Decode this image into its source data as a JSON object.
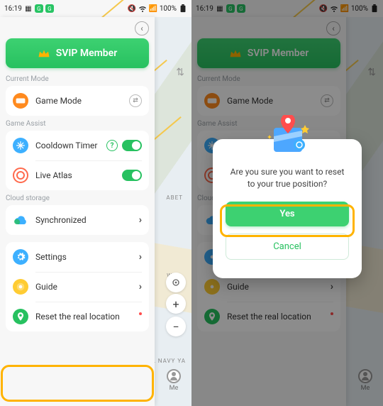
{
  "status": {
    "time": "16:19",
    "battery": "100%",
    "icons": {
      "mute": "mute-icon",
      "wifi": "wifi-icon",
      "signal": "signal-icon",
      "batt": "battery-icon",
      "sq": "app-badge"
    }
  },
  "svip_label": "SVIP Member",
  "sections": {
    "current_mode": "Current Mode",
    "game_assist": "Game Assist",
    "cloud_storage": "Cloud storage"
  },
  "rows": {
    "game_mode": "Game Mode",
    "cooldown": "Cooldown Timer",
    "live_atlas": "Live Atlas",
    "synchronized": "Synchronized",
    "settings": "Settings",
    "guide": "Guide",
    "reset_location": "Reset the real location"
  },
  "map": {
    "loc1": "ABET",
    "loc2": "Willi",
    "loc3": "BROOKL\nNAVY YA",
    "me_label": "Me",
    "plus": "+",
    "minus": "−"
  },
  "dialog": {
    "message": "Are you sure you want to reset to your true position?",
    "yes": "Yes",
    "cancel": "Cancel"
  }
}
